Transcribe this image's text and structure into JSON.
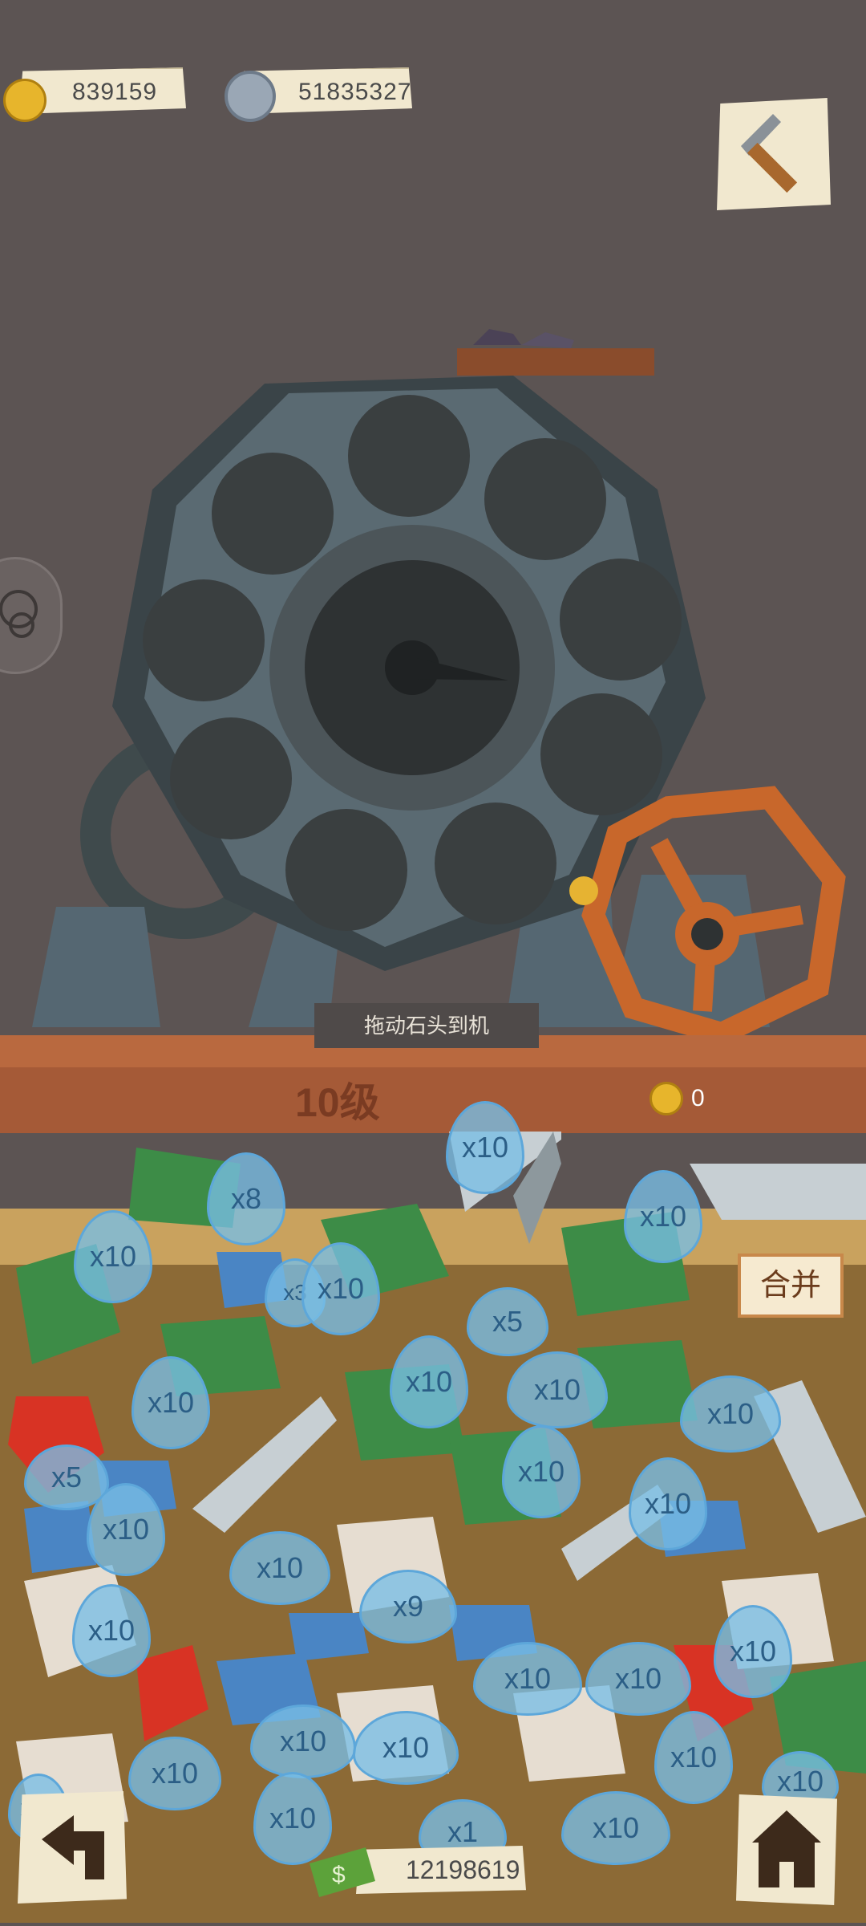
{
  "top_bar": {
    "medals_value": "839159",
    "gears_value": "51835327"
  },
  "machine": {
    "hint_text": "拖动石头到机",
    "level_label": "10级",
    "reward_count": "0"
  },
  "box": {
    "merge_label": "合并",
    "cash_value": "12198619",
    "badges": [
      "x10",
      "x8",
      "x10",
      "x3",
      "x10",
      "x10",
      "x5",
      "x10",
      "x10",
      "x10",
      "x10",
      "x10",
      "x5",
      "x10",
      "x10",
      "x10",
      "x10",
      "x9",
      "x10",
      "x10",
      "x10",
      "x10",
      "x10",
      "x10",
      "x10",
      "x10",
      "x10",
      "x10",
      "x1",
      "x10"
    ]
  },
  "colors": {
    "background": "#5c5453",
    "platform": "#a55a37",
    "box": "#8c6a36",
    "badge_blue": "#78bee6",
    "wheel_orange": "#c8672b"
  },
  "icons": [
    "medal-icon",
    "gear-coin-icon",
    "pickaxe-icon",
    "chat-icon",
    "undo-icon",
    "shop-icon",
    "cash-icon"
  ]
}
